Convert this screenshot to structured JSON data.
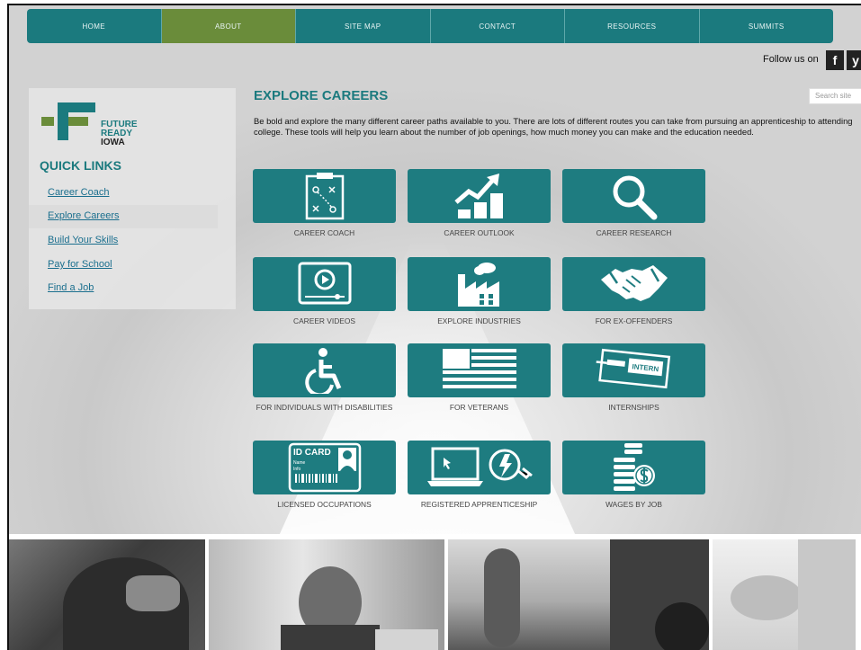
{
  "nav": {
    "items": [
      "HOME",
      "ABOUT",
      "SITE MAP",
      "CONTACT",
      "RESOURCES",
      "SUMMITS"
    ],
    "active": "ABOUT",
    "accent": "#1b7a7e",
    "active_color": "#6a8c3a"
  },
  "social": {
    "follow_text": "Follow us on",
    "facebook": "f",
    "twitter": "y"
  },
  "search": {
    "placeholder": "Search site"
  },
  "logo": {
    "line1": "FUTURE",
    "line2": "READY",
    "line3": "IOWA"
  },
  "sidebar": {
    "title": "QUICK LINKS",
    "items": [
      "Career Coach",
      "Explore Careers",
      "Build Your Skills",
      "Pay for School",
      "Find a Job"
    ]
  },
  "main": {
    "heading": "EXPLORE CAREERS",
    "intro": "Be bold and explore the many different career paths available to you. There are lots of different routes you can take from pursuing an apprenticeship to attending college. These tools will help you learn about the number of job openings, how much money you can make and the education needed."
  },
  "tiles": [
    {
      "label": "CAREER COACH",
      "icon": "clipboard-play-icon"
    },
    {
      "label": "CAREER OUTLOOK",
      "icon": "growth-chart-icon"
    },
    {
      "label": "CAREER RESEARCH",
      "icon": "magnifier-icon"
    },
    {
      "label": "CAREER VIDEOS",
      "icon": "video-player-icon"
    },
    {
      "label": "EXPLORE INDUSTRIES",
      "icon": "factory-icon"
    },
    {
      "label": "FOR EX-OFFENDERS",
      "icon": "handshake-icon"
    },
    {
      "label": "FOR INDIVIDUALS WITH DISABILITIES",
      "icon": "wheelchair-icon"
    },
    {
      "label": "FOR VETERANS",
      "icon": "flag-icon"
    },
    {
      "label": "INTERNSHIPS",
      "icon": "intern-tag-icon"
    },
    {
      "label": "LICENSED OCCUPATIONS",
      "icon": "id-card-icon"
    },
    {
      "label": "REGISTERED APPRENTICESHIP",
      "icon": "laptop-plug-icon"
    },
    {
      "label": "WAGES BY JOB",
      "icon": "coin-stack-icon"
    }
  ],
  "icon_text": {
    "intern": "INTERN",
    "id_card": "ID CARD",
    "name": "Name",
    "info": "Info"
  }
}
